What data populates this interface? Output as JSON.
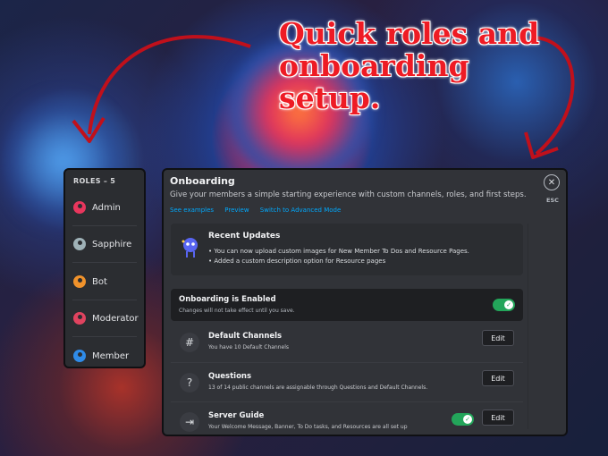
{
  "headline": {
    "line1": "Quick roles and",
    "line2": "onboarding",
    "line3": "setup."
  },
  "colors": {
    "headline": "#ee1b24",
    "accent_link": "#00a8fc",
    "toggle_on": "#23a55a"
  },
  "roles": {
    "header": "ROLES – 5",
    "items": [
      {
        "label": "Admin",
        "color": "#e8365d"
      },
      {
        "label": "Sapphire",
        "color": "#9fb2b8"
      },
      {
        "label": "Bot",
        "color": "#f0922b"
      },
      {
        "label": "Moderator",
        "color": "#e0435f"
      },
      {
        "label": "Member",
        "color": "#2f8be8"
      }
    ]
  },
  "onboarding": {
    "title": "Onboarding",
    "subtitle": "Give your members a simple starting experience with custom channels, roles, and first steps.",
    "links": [
      "See examples",
      "Preview",
      "Switch to Advanced Mode"
    ],
    "close_icon": "close-icon",
    "esc_label": "ESC",
    "recent_updates": {
      "title": "Recent Updates",
      "lines": [
        "• You can now upload custom images for New Member To Dos and Resource Pages.",
        "• Added a custom description option for Resource pages"
      ]
    },
    "enabled": {
      "title": "Onboarding is Enabled",
      "subtitle": "Changes will not take effect until you save.",
      "on": true
    },
    "rows": [
      {
        "title": "Default Channels",
        "subtitle": "You have 10 Default Channels",
        "icon": "hash-icon",
        "button": "Edit",
        "toggle": false
      },
      {
        "title": "Questions",
        "subtitle": "13 of 14 public channels are assignable through Questions and Default Channels.",
        "icon": "question-icon",
        "button": "Edit",
        "toggle": false
      },
      {
        "title": "Server Guide",
        "subtitle": "Your Welcome Message, Banner, To Do tasks, and Resources are all set up",
        "icon": "signpost-icon",
        "button": "Edit",
        "toggle": true
      }
    ]
  }
}
